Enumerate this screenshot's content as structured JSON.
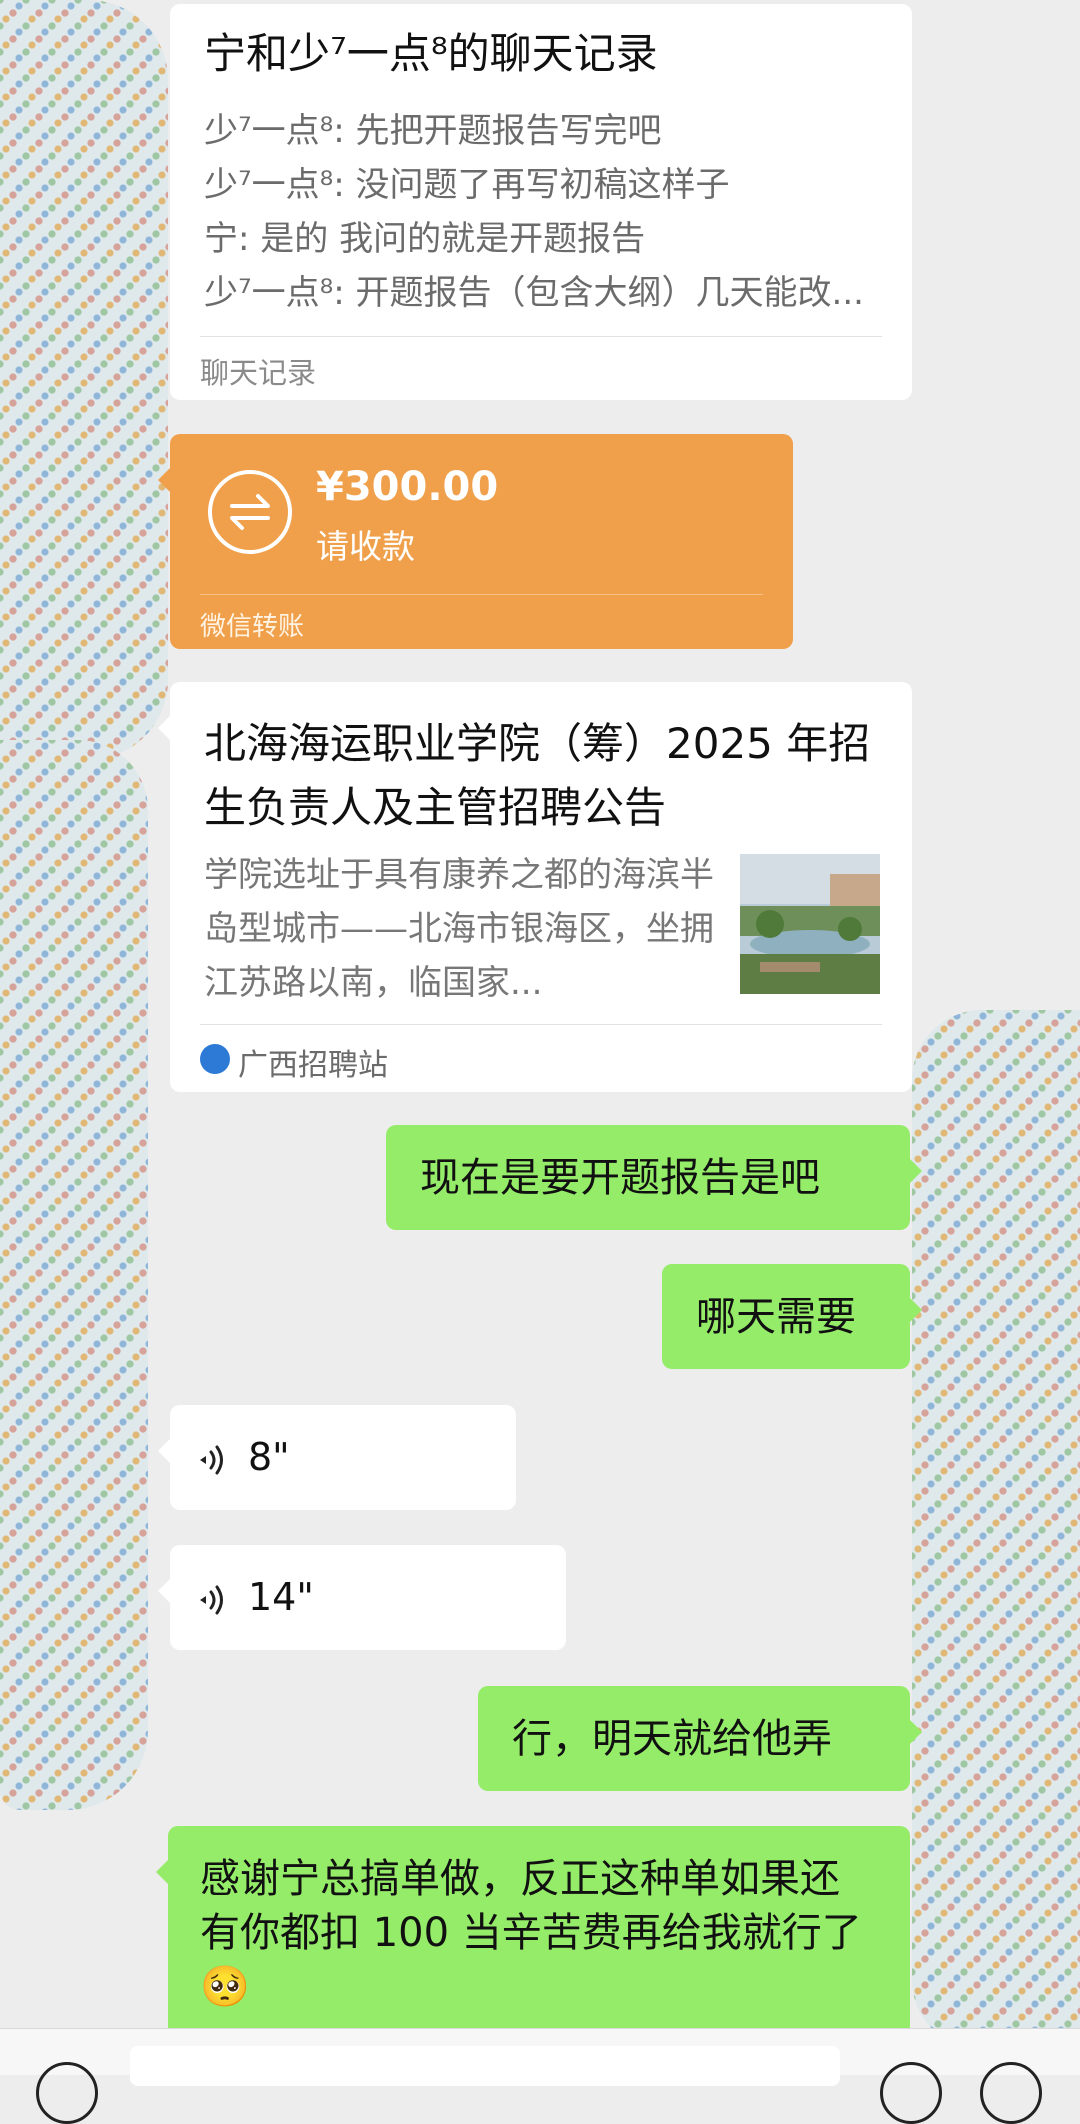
{
  "chat_record": {
    "title": "宁和少⁷一点⁸的聊天记录",
    "lines": [
      "少⁷一点⁸: 先把开题报告写完吧",
      "少⁷一点⁸: 没问题了再写初稿这样子",
      "宁: 是的 我问的就是开题报告",
      "少⁷一点⁸: 开题报告（包含大纲）几天能改..."
    ],
    "footer": "聊天记录"
  },
  "transfer": {
    "amount": "¥300.00",
    "status": "请收款",
    "footer": "微信转账",
    "icon": "transfer-arrows-icon"
  },
  "article": {
    "title": "北海海运职业学院（筹）2025 年招生负责人及主管招聘公告",
    "description": "学院选址于具有康养之都的海滨半岛型城市——北海市银海区，坐拥江苏路以南，临国家...",
    "source": "广西招聘站"
  },
  "messages": {
    "m1": "现在是要开题报告是吧",
    "m2": "哪天需要",
    "voice1": "8\"",
    "voice2": "14\"",
    "m3": "行，明天就给他弄",
    "m4": "感谢宁总搞单做，反正这种单如果还有你都扣 100 当辛苦费再给我就行了🥺"
  },
  "colors": {
    "background": "#ededed",
    "outgoing_bubble": "#95ec69",
    "transfer_card": "#f0a04b"
  }
}
